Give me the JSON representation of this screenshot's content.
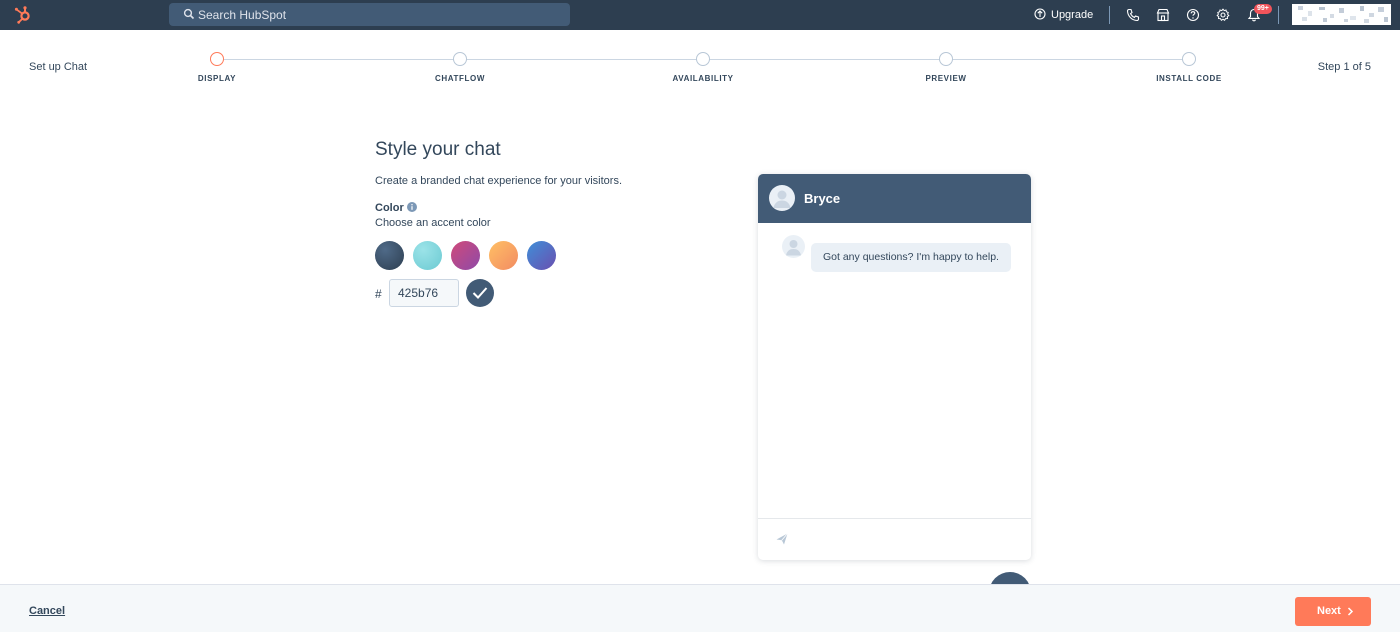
{
  "nav": {
    "search_placeholder": "Search HubSpot",
    "upgrade_label": "Upgrade",
    "notification_count": "99+"
  },
  "stepper": {
    "setup_label": "Set up Chat",
    "step_count": "Step 1 of 5",
    "steps": [
      {
        "label": "DISPLAY",
        "active": true
      },
      {
        "label": "CHATFLOW",
        "active": false
      },
      {
        "label": "AVAILABILITY",
        "active": false
      },
      {
        "label": "PREVIEW",
        "active": false
      },
      {
        "label": "INSTALL CODE",
        "active": false
      }
    ]
  },
  "form": {
    "title": "Style your chat",
    "description": "Create a branded chat experience for your visitors.",
    "color_label": "Color",
    "color_sublabel": "Choose an accent color",
    "swatches": [
      "#425b76",
      "#7fd1d8",
      "#b94a8c",
      "#f5a55a",
      "#5165b3"
    ],
    "hash_symbol": "#",
    "hex_value": "425b76"
  },
  "chat": {
    "agent_name": "Bryce",
    "message": "Got any questions? I'm happy to help.",
    "accent_color": "#425b76"
  },
  "footer": {
    "cancel_label": "Cancel",
    "next_label": "Next"
  },
  "colors": {
    "brand_orange": "#ff7a59",
    "nav_bg": "#2d3e50",
    "text": "#33475b"
  }
}
